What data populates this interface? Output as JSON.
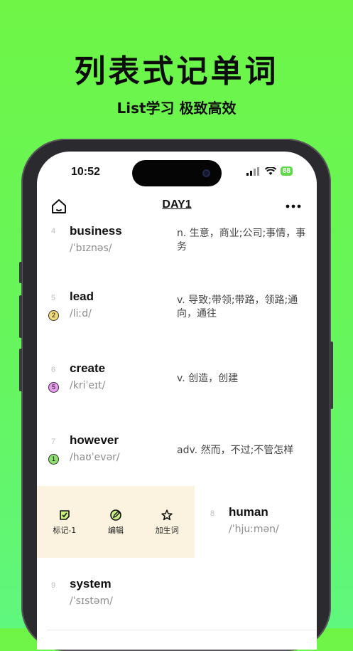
{
  "promo": {
    "headline": "列表式记单词",
    "subline": "List学习 极致高效"
  },
  "status_bar": {
    "time": "10:52",
    "battery": "88"
  },
  "nav": {
    "title": "DAY1",
    "home_icon": "home-icon",
    "more_icon": "more-icon"
  },
  "words": [
    {
      "index": "4",
      "word": "business",
      "phonetic": "/ˈbɪznəs/",
      "meaning": "n. 生意，商业;公司;事情，事务",
      "badge": ""
    },
    {
      "index": "5",
      "word": "lead",
      "phonetic": "/liːd/",
      "meaning": "v. 导致;带领;带路，领路;通向，通往",
      "badge": "2",
      "badge_color": "#f4d97a"
    },
    {
      "index": "6",
      "word": "create",
      "phonetic": "/kriˈeɪt/",
      "meaning": "v. 创造，创建",
      "badge": "5",
      "badge_color": "#e79bf0"
    },
    {
      "index": "7",
      "word": "however",
      "phonetic": "/haʊˈevər/",
      "meaning": "adv. 然而，不过;不管怎样",
      "badge": "1",
      "badge_color": "#8de070"
    },
    {
      "index": "8",
      "word": "human",
      "phonetic": "/ˈhjuːmən/",
      "meaning": "",
      "badge": ""
    },
    {
      "index": "9",
      "word": "system",
      "phonetic": "/ˈsɪstəm/",
      "meaning": "",
      "badge": ""
    }
  ],
  "swipe_actions": [
    {
      "label": "标记-1",
      "icon": "mark-icon"
    },
    {
      "label": "编辑",
      "icon": "edit-icon"
    },
    {
      "label": "加生词",
      "icon": "star-icon"
    }
  ]
}
